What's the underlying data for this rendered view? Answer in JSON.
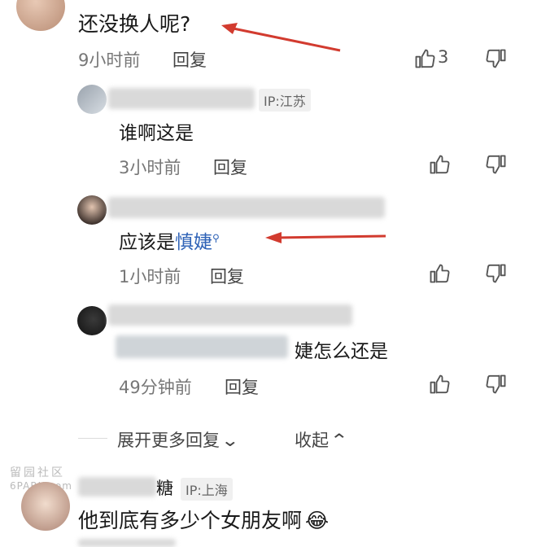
{
  "main_comment": {
    "text": "还没换人呢?",
    "time": "9小时前",
    "reply_label": "回复",
    "like_count": "3"
  },
  "replies": [
    {
      "username": "",
      "ip_tag": "IP:江苏",
      "text": "谁啊这是",
      "time": "3小时前",
      "reply_label": "回复"
    },
    {
      "username": "",
      "text_prefix": "应该是",
      "text_link": "慎婕",
      "time": "1小时前",
      "reply_label": "回复"
    },
    {
      "username": "",
      "text": "婕怎么还是",
      "time": "49分钟前",
      "reply_label": "回复"
    }
  ],
  "thread_controls": {
    "expand_label": "展开更多回复",
    "collapse_label": "收起"
  },
  "next_comment": {
    "username_visible": "糖",
    "ip_tag": "IP:上海",
    "text": "他到底有多少个女朋友啊",
    "emoji": "😂"
  },
  "watermark": {
    "chinese": "留园社区",
    "latin": "6PARK.com"
  },
  "colors": {
    "link": "#2f63b7",
    "arrow": "#d23b2f"
  }
}
